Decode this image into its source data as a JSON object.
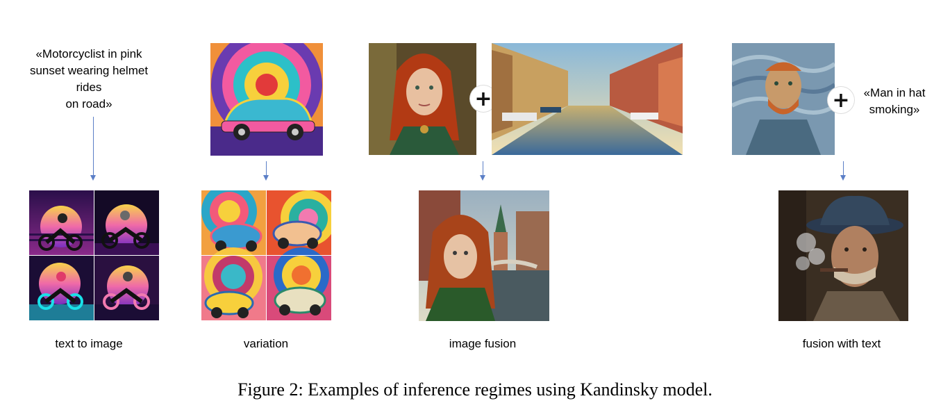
{
  "panels": {
    "t2i": {
      "prompt_lines": [
        "«Motorcyclist in pink",
        "sunset wearing helmet",
        "rides",
        "on road»"
      ],
      "label": "text to image"
    },
    "variation": {
      "label": "variation"
    },
    "fusion": {
      "label": "image fusion",
      "plus": "+"
    },
    "fusion_text": {
      "prompt_lines": [
        "«Man in hat",
        "smoking»"
      ],
      "label": "fusion with text",
      "plus": "+"
    }
  },
  "caption": "Figure 2: Examples of inference regimes using Kandinsky model.",
  "colors": {
    "arrow": "#5b7fc7"
  }
}
